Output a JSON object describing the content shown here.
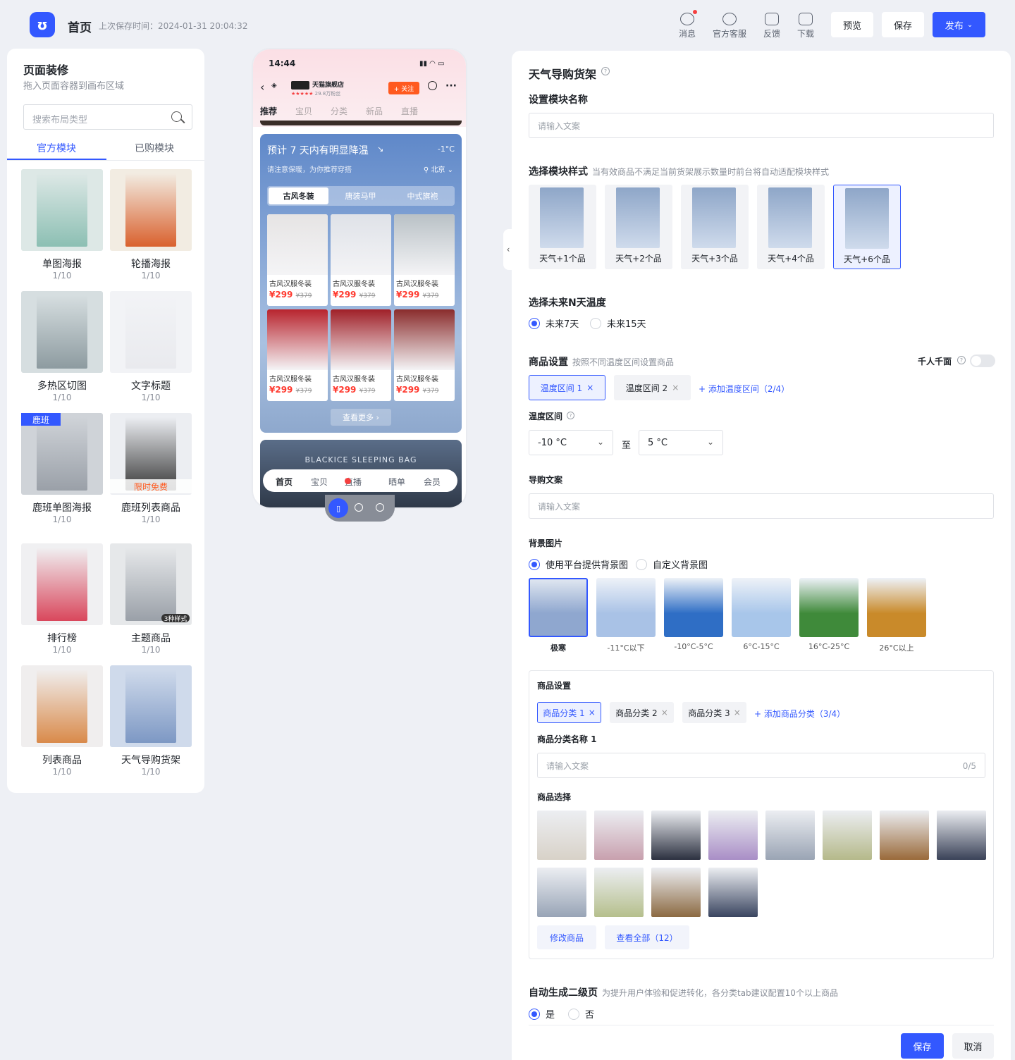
{
  "header": {
    "title": "首页",
    "save_time": "上次保存时间：2024-01-31 20:04:32",
    "icons": [
      {
        "label": "消息",
        "icon": "message-icon"
      },
      {
        "label": "官方客服",
        "icon": "customer-service-icon"
      },
      {
        "label": "反馈",
        "icon": "feedback-icon"
      },
      {
        "label": "下载",
        "icon": "download-icon"
      }
    ],
    "preview": "预览",
    "save": "保存",
    "publish": "发布"
  },
  "left": {
    "title": "页面装修",
    "subtitle": "拖入页面容器到画布区域",
    "search_placeholder": "搜索布局类型",
    "tabs": [
      "官方模块",
      "已购模块"
    ],
    "modules": [
      {
        "name": "单图海报",
        "count": "1/10"
      },
      {
        "name": "轮播海报",
        "count": "1/10"
      },
      {
        "name": "多热区切图",
        "count": "1/10"
      },
      {
        "name": "文字标题",
        "count": "1/10"
      },
      {
        "name": "鹿班单图海报",
        "count": "1/10"
      },
      {
        "name": "鹿班列表商品",
        "count": "1/10"
      },
      {
        "name": "排行榜",
        "count": "1/10"
      },
      {
        "name": "主题商品",
        "count": "1/10"
      },
      {
        "name": "列表商品",
        "count": "1/10"
      },
      {
        "name": "天气导购货架",
        "count": "1/10"
      }
    ],
    "badges": {
      "luban": "鹿班",
      "free": "限时免费",
      "styles": "3种样式"
    }
  },
  "phone": {
    "time": "14:44",
    "shop_name": "天猫旗舰店",
    "fans": "29.8万粉丝",
    "follow": "+ 关注",
    "nav": [
      "推荐",
      "宝贝",
      "分类",
      "新品",
      "直播"
    ],
    "weather_title": "预计 7 天内有明显降温",
    "temp": "-1°C",
    "weather_sub": "请注意保暖，为你推荐穿搭",
    "city": "北京",
    "tabs": [
      "古风冬装",
      "唐装马甲",
      "中式旗袍"
    ],
    "products": [
      {
        "name": "古风汉服冬装",
        "price": "¥299",
        "orig": "¥379"
      },
      {
        "name": "古风汉服冬装",
        "price": "¥299",
        "orig": "¥379"
      },
      {
        "name": "古风汉服冬装",
        "price": "¥299",
        "orig": "¥379"
      },
      {
        "name": "古风汉服冬装",
        "price": "¥299",
        "orig": "¥379"
      },
      {
        "name": "古风汉服冬装",
        "price": "¥299",
        "orig": "¥379"
      },
      {
        "name": "古风汉服冬装",
        "price": "¥299",
        "orig": "¥379"
      }
    ],
    "more": "查看更多 ›",
    "banner": "BLACKICE SLEEPING BAG",
    "bottom_nav": [
      "首页",
      "宝贝",
      "直播",
      "晒单",
      "会员"
    ]
  },
  "right": {
    "title": "天气导购货架",
    "name_label": "设置模块名称",
    "name_placeholder": "请输入文案",
    "style_label": "选择模块样式",
    "style_hint": "当有效商品不满足当前货架展示数量时前台将自动适配模块样式",
    "styles": [
      "天气+1个品",
      "天气+2个品",
      "天气+3个品",
      "天气+4个品",
      "天气+6个品"
    ],
    "days_label": "选择未来N天温度",
    "days": [
      "未来7天",
      "未来15天"
    ],
    "goods_label": "商品设置",
    "goods_hint": "按照不同温度区间设置商品",
    "personal": "千人千面",
    "ranges": [
      "温度区间 1",
      "温度区间 2"
    ],
    "add_range": "+ 添加温度区间（2/4）",
    "range_label": "温度区间",
    "range_from": "-10 °C",
    "range_to": "5 °C",
    "range_sep": "至",
    "copy_label": "导购文案",
    "copy_placeholder": "请输入文案",
    "bg_label": "背景图片",
    "bg_options": [
      "使用平台提供背景图",
      "自定义背景图"
    ],
    "bgs": [
      {
        "name": "极寒",
        "c": "#8fa7cf"
      },
      {
        "name": "-11°C以下",
        "c": "#a9c2e6"
      },
      {
        "name": "-10°C-5°C",
        "c": "#2f6ec5"
      },
      {
        "name": "6°C-15°C",
        "c": "#a8c6ea"
      },
      {
        "name": "16°C-25°C",
        "c": "#3f8a3a"
      },
      {
        "name": "26°C以上",
        "c": "#c98a2a"
      }
    ],
    "inner_title": "商品设置",
    "cats": [
      "商品分类 1",
      "商品分类 2",
      "商品分类 3"
    ],
    "add_cat": "+ 添加商品分类（3/4）",
    "cat_name_label": "商品分类名称 1",
    "cat_placeholder": "请输入文案",
    "cat_counter": "0/5",
    "select_label": "商品选择",
    "edit": "修改商品",
    "view_all": "查看全部（12）",
    "auto_label": "自动生成二级页",
    "auto_hint": "为提升用户体验和促进转化，各分类tab建议配置10个以上商品",
    "auto_opts": [
      "是",
      "否"
    ],
    "save": "保存",
    "cancel": "取消",
    "goods_colors": [
      "#d8d2c8",
      "#c8a0ae",
      "#2c3140",
      "#a98ec6",
      "#9aa4b4",
      "#b5b98a",
      "#9a6a3a",
      "#3a4258",
      "#98a4b6",
      "#b5bf8c",
      "#8c6a42",
      "#3a4560"
    ]
  }
}
